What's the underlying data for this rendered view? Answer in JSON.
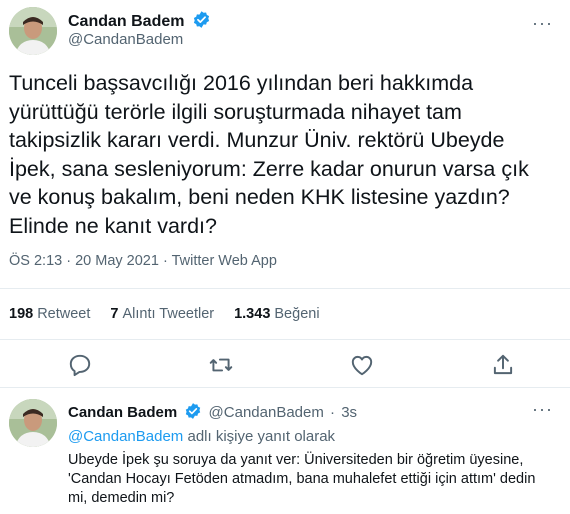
{
  "tweet": {
    "display_name": "Candan Badem",
    "handle": "@CandanBadem",
    "text": "Tunceli başsavcılığı 2016 yılından beri hakkımda yürüttüğü terörle ilgili soruşturmada nihayet tam takipsizlik kararı verdi. Munzur Üniv. rektörü Ubeyde İpek, sana sesleniyorum: Zerre kadar onurun varsa çık ve konuş bakalım, beni neden KHK listesine yazdın? Elinde ne kanıt vardı?",
    "time": "ÖS 2:13",
    "date": "20 May 2021",
    "source": "Twitter Web App",
    "more_icon": "more-icon",
    "verified_icon": "verified-icon"
  },
  "stats": {
    "retweets_count": "198",
    "retweets_label": "Retweet",
    "quotes_count": "7",
    "quotes_label": "Alıntı Tweetler",
    "likes_count": "1.343",
    "likes_label": "Beğeni"
  },
  "actions": [
    "reply-icon",
    "retweet-icon",
    "like-icon",
    "share-icon"
  ],
  "reply": {
    "display_name": "Candan Badem",
    "handle": "@CandanBadem",
    "separator": "·",
    "time": "3s",
    "replying_mention": "@CandanBadem",
    "replying_suffix": "adlı kişiye yanıt olarak",
    "text": "Ubeyde İpek şu soruya da yanıt ver: Üniversiteden bir öğretim üyesine, 'Candan Hocayı Fetöden atmadım, bana muhalefet ettiği için attım' dedin mi, demedin mi?"
  },
  "colors": {
    "text": "#0f1419",
    "secondary": "#536471",
    "accent": "#1d9bf0",
    "divider": "#e6ecf0"
  }
}
